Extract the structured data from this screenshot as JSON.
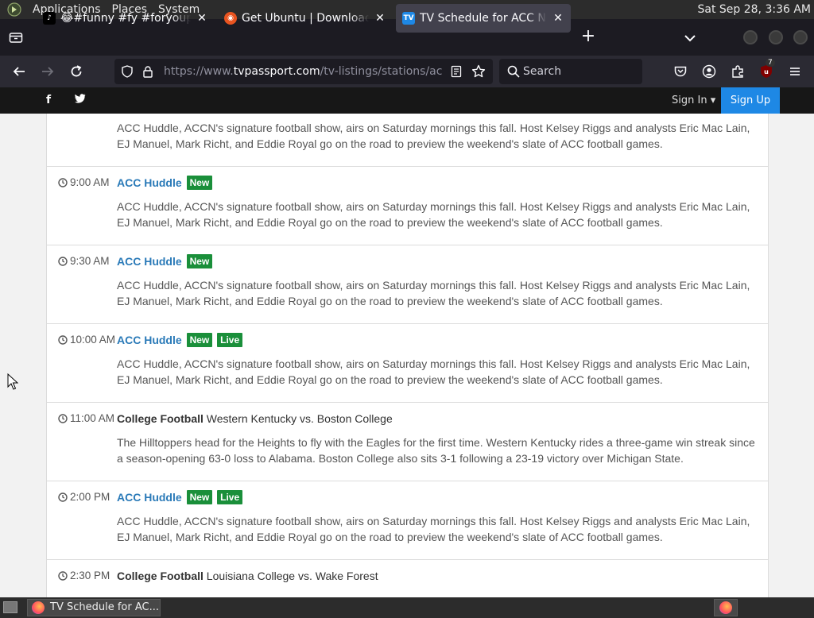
{
  "panel": {
    "menus": [
      "Applications",
      "Places",
      "System"
    ],
    "clock": "Sat Sep 28,  3:36 AM"
  },
  "tabs": [
    {
      "title": "😂#funny #fy #foryoupage",
      "favicon": "tiktok-icon",
      "active": false
    },
    {
      "title": "Get Ubuntu | Download | Ubuntu",
      "favicon": "ubuntu-icon",
      "active": false
    },
    {
      "title": "TV Schedule for ACC Network",
      "favicon": "tvpassport-icon",
      "active": true
    }
  ],
  "urlbar": {
    "prefix": "https://www.",
    "domain": "tvpassport.com",
    "path": "/tv-listings/stations/acc-network"
  },
  "search": {
    "placeholder": "Search"
  },
  "extension_badge": "7",
  "site_header": {
    "sign_in": "Sign In ▾",
    "sign_up": "Sign Up"
  },
  "listings": [
    {
      "time": "",
      "show": "",
      "show_kind": "none",
      "subtitle": "",
      "badges": [],
      "description": "ACC Huddle, ACCN's signature football show, airs on Saturday mornings this fall. Host Kelsey Riggs and analysts Eric Mac Lain, EJ Manuel, Mark Richt, and Eddie Royal go on the road to preview the weekend's slate of ACC football games."
    },
    {
      "time": "9:00 AM",
      "show": "ACC Huddle",
      "show_kind": "link",
      "subtitle": "",
      "badges": [
        "New"
      ],
      "description": "ACC Huddle, ACCN's signature football show, airs on Saturday mornings this fall. Host Kelsey Riggs and analysts Eric Mac Lain, EJ Manuel, Mark Richt, and Eddie Royal go on the road to preview the weekend's slate of ACC football games."
    },
    {
      "time": "9:30 AM",
      "show": "ACC Huddle",
      "show_kind": "link",
      "subtitle": "",
      "badges": [
        "New"
      ],
      "description": "ACC Huddle, ACCN's signature football show, airs on Saturday mornings this fall. Host Kelsey Riggs and analysts Eric Mac Lain, EJ Manuel, Mark Richt, and Eddie Royal go on the road to preview the weekend's slate of ACC football games."
    },
    {
      "time": "10:00 AM",
      "show": "ACC Huddle",
      "show_kind": "link",
      "subtitle": "",
      "badges": [
        "New",
        "Live"
      ],
      "description": "ACC Huddle, ACCN's signature football show, airs on Saturday mornings this fall. Host Kelsey Riggs and analysts Eric Mac Lain, EJ Manuel, Mark Richt, and Eddie Royal go on the road to preview the weekend's slate of ACC football games."
    },
    {
      "time": "11:00 AM",
      "show": "College Football",
      "show_kind": "bold",
      "subtitle": "Western Kentucky vs. Boston College",
      "badges": [],
      "description": "The Hilltoppers head for the Heights to fly with the Eagles for the first time. Western Kentucky rides a three-game win streak since a season-opening 63-0 loss to Alabama. Boston College also sits 3-1 following a 23-19 victory over Michigan State."
    },
    {
      "time": "2:00 PM",
      "show": "ACC Huddle",
      "show_kind": "link",
      "subtitle": "",
      "badges": [
        "New",
        "Live"
      ],
      "description": "ACC Huddle, ACCN's signature football show, airs on Saturday mornings this fall. Host Kelsey Riggs and analysts Eric Mac Lain, EJ Manuel, Mark Richt, and Eddie Royal go on the road to preview the weekend's slate of ACC football games."
    },
    {
      "time": "2:30 PM",
      "show": "College Football",
      "show_kind": "bold",
      "subtitle": "Louisiana College vs. Wake Forest",
      "badges": [],
      "description": ""
    }
  ],
  "taskbar": {
    "task_title": "TV Schedule for AC..."
  },
  "colors": {
    "link": "#2a7ab8",
    "badge": "#1a8f3a",
    "signup": "#1e88e5"
  }
}
